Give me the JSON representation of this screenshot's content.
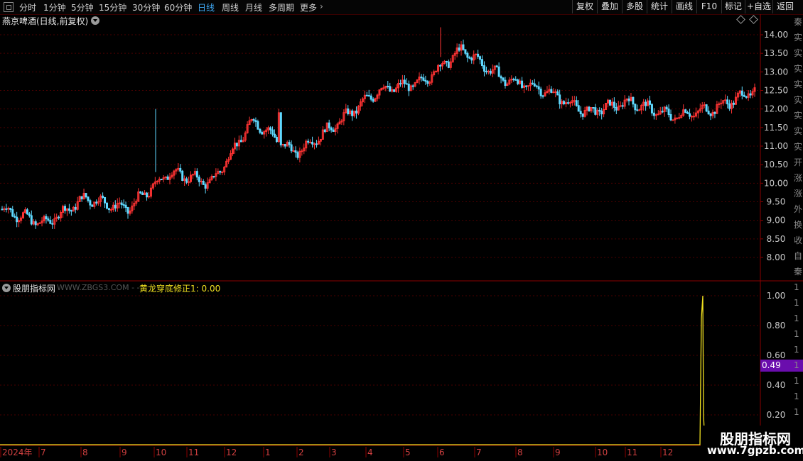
{
  "toolbar": {
    "periods": [
      "分时",
      "1分钟",
      "5分钟",
      "15分钟",
      "30分钟",
      "60分钟",
      "日线",
      "周线",
      "月线",
      "多周期",
      "更多"
    ],
    "active_period": "日线",
    "buttons": [
      "复权",
      "叠加",
      "多股",
      "统计",
      "画线",
      "F10",
      "标记",
      "+自选",
      "返回"
    ]
  },
  "chart": {
    "title": "燕京啤酒(日线,前复权)",
    "price_axis": [
      "14.00",
      "13.50",
      "13.00",
      "12.50",
      "12.00",
      "11.50",
      "11.00",
      "10.50",
      "10.00",
      "9.50",
      "9.00",
      "8.50",
      "8.00"
    ],
    "indicator_axis": [
      "1.00",
      "0.80",
      "0.60",
      "0.40",
      "0.20"
    ],
    "indicator_badge": "0.49",
    "time_axis": [
      "2024年",
      "7",
      "8",
      "9",
      "10",
      "11",
      "12",
      "1",
      "2",
      "3",
      "4",
      "5",
      "6",
      "7",
      "8",
      "9",
      "10",
      "11",
      "12"
    ]
  },
  "indicator": {
    "name": "股朋指标网",
    "site": "WWW.ZBGS3.COM - -",
    "value_label": "黄龙穿底修正1: 0.00"
  },
  "colors": {
    "up": "#ff3333",
    "down": "#5fd9ff",
    "indicator": "#f0e020",
    "badge": "#6a0dad"
  },
  "watermark": {
    "title": "股朋指标网",
    "url": "www.7gpzb.com"
  },
  "chart_data": {
    "type": "candlestick",
    "ylim": [
      7.5,
      14.5
    ],
    "monthly_close": [
      9.3,
      8.9,
      9.6,
      9.3,
      10.3,
      10.0,
      11.7,
      10.8,
      11.6,
      12.5,
      12.7,
      13.6,
      12.8,
      12.5,
      11.9,
      12.2,
      11.8,
      12.0,
      12.5
    ]
  }
}
